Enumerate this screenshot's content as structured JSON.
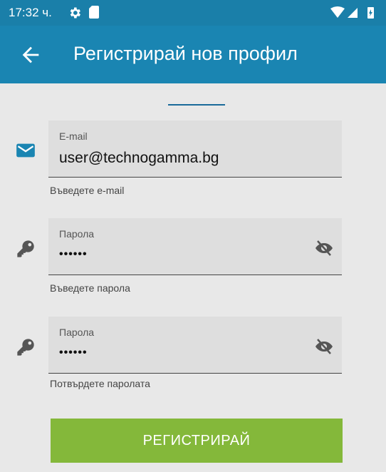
{
  "status_bar": {
    "time": "17:32 ч."
  },
  "app_bar": {
    "title": "Регистрирай нов профил"
  },
  "email_field": {
    "label": "E-mail",
    "value": "user@technogamma.bg",
    "helper": "Въведете e-mail"
  },
  "password_field": {
    "label": "Парола",
    "value": "••••••",
    "helper": "Въведете парола"
  },
  "confirm_field": {
    "label": "Парола",
    "value": "••••••",
    "helper": "Потвърдете паролата"
  },
  "register_button": {
    "label": "РЕГИСТРИРАЙ"
  },
  "colors": {
    "app_bar": "#1a85b2",
    "status_bar": "#1a7fa9",
    "button": "#84b83a",
    "email_icon": "#1a85b2",
    "background": "#e8e8e8"
  },
  "icons": [
    "gear-icon",
    "sd-card-icon",
    "wifi-icon",
    "signal-icon",
    "battery-icon",
    "back-arrow-icon",
    "email-icon",
    "key-icon",
    "eye-off-icon"
  ]
}
